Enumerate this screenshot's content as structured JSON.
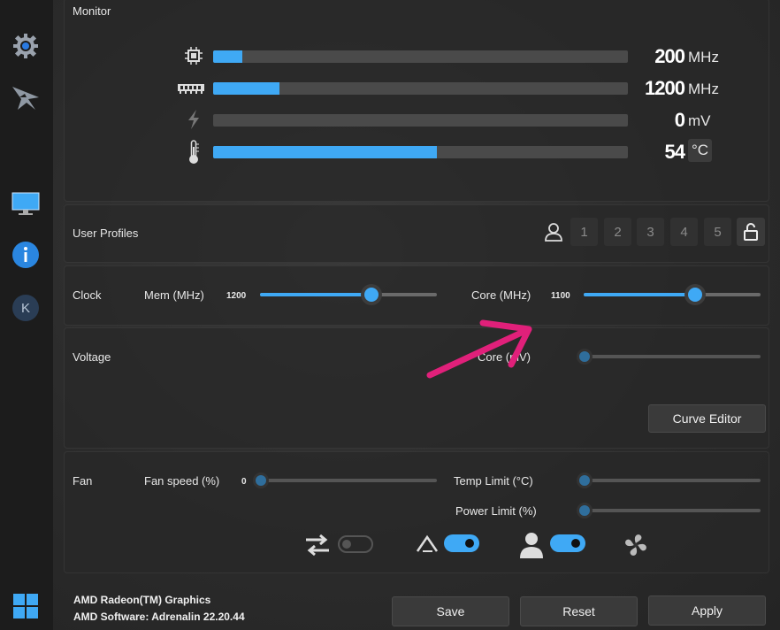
{
  "monitor": {
    "title": "Monitor",
    "rows": [
      {
        "icon": "chip-icon",
        "value": "200",
        "unit": "MHz",
        "fill": 0.07
      },
      {
        "icon": "memory-icon",
        "value": "1200",
        "unit": "MHz",
        "fill": 0.16
      },
      {
        "icon": "lightning-icon",
        "value": "0",
        "unit": "mV",
        "fill": 0
      },
      {
        "icon": "thermometer-icon",
        "value": "54",
        "unit": "°C",
        "fill": 0.54
      }
    ]
  },
  "profiles": {
    "title": "User Profiles",
    "slots": [
      "1",
      "2",
      "3",
      "4",
      "5"
    ]
  },
  "clock": {
    "title": "Clock",
    "mem_label": "Mem (MHz)",
    "mem_value": "1200",
    "mem_fill": 0.71,
    "core_label": "Core (MHz)",
    "core_value": "1100",
    "core_fill": 0.63
  },
  "voltage": {
    "title": "Voltage",
    "core_label": "Core (mV)",
    "curve_editor": "Curve Editor"
  },
  "fan": {
    "title": "Fan",
    "speed_label": "Fan speed (%)",
    "speed_value": "0",
    "temp_label": "Temp Limit (°C)",
    "power_label": "Power Limit (%)"
  },
  "footer": {
    "gpu": "AMD Radeon(TM) Graphics",
    "software": "AMD Software: Adrenalin 22.20.44",
    "save": "Save",
    "reset": "Reset",
    "apply": "Apply"
  },
  "colors": {
    "accent": "#3fa9f5",
    "annotation": "#e0207a"
  }
}
